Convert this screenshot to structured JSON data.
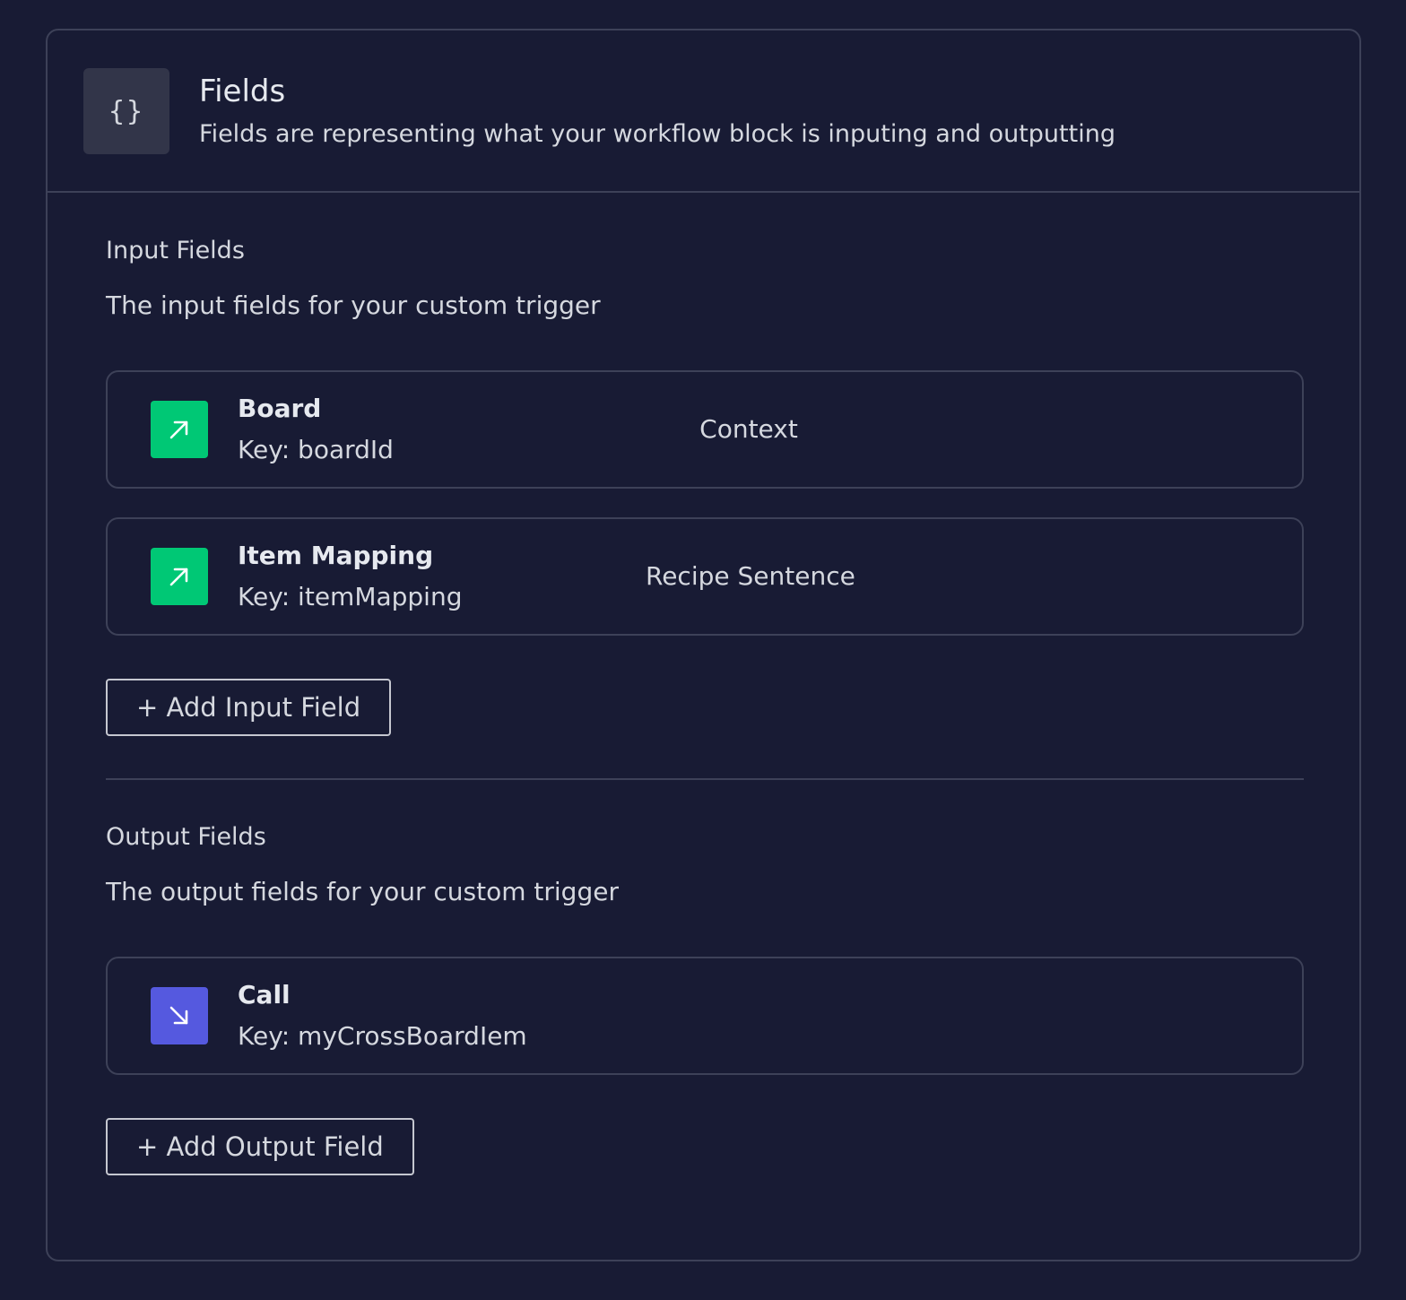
{
  "header": {
    "icon_text": "{}",
    "icon_name": "curly-braces-icon",
    "title": "Fields",
    "subtitle": "Fields are representing what your workflow block is inputing and outputting"
  },
  "input_section": {
    "title": "Input Fields",
    "description": "The input fields for your custom trigger",
    "fields": [
      {
        "name": "Board",
        "key": "Key: boardId",
        "type": "Context",
        "icon": "arrow-up-right-icon"
      },
      {
        "name": "Item Mapping",
        "key": "Key: itemMapping",
        "type": "Recipe Sentence",
        "icon": "arrow-up-right-icon"
      }
    ],
    "add_label": "+ Add Input Field"
  },
  "output_section": {
    "title": "Output Fields",
    "description": "The output fields for your custom trigger",
    "fields": [
      {
        "name": "Call",
        "key": "Key: myCrossBoardIem",
        "type": "",
        "icon": "arrow-down-right-icon"
      }
    ],
    "add_label": "+ Add Output Field"
  },
  "colors": {
    "background": "#181b34",
    "border": "#3d4158",
    "input_accent": "#00c875",
    "output_accent": "#5559df",
    "header_icon_bg": "#323549"
  }
}
